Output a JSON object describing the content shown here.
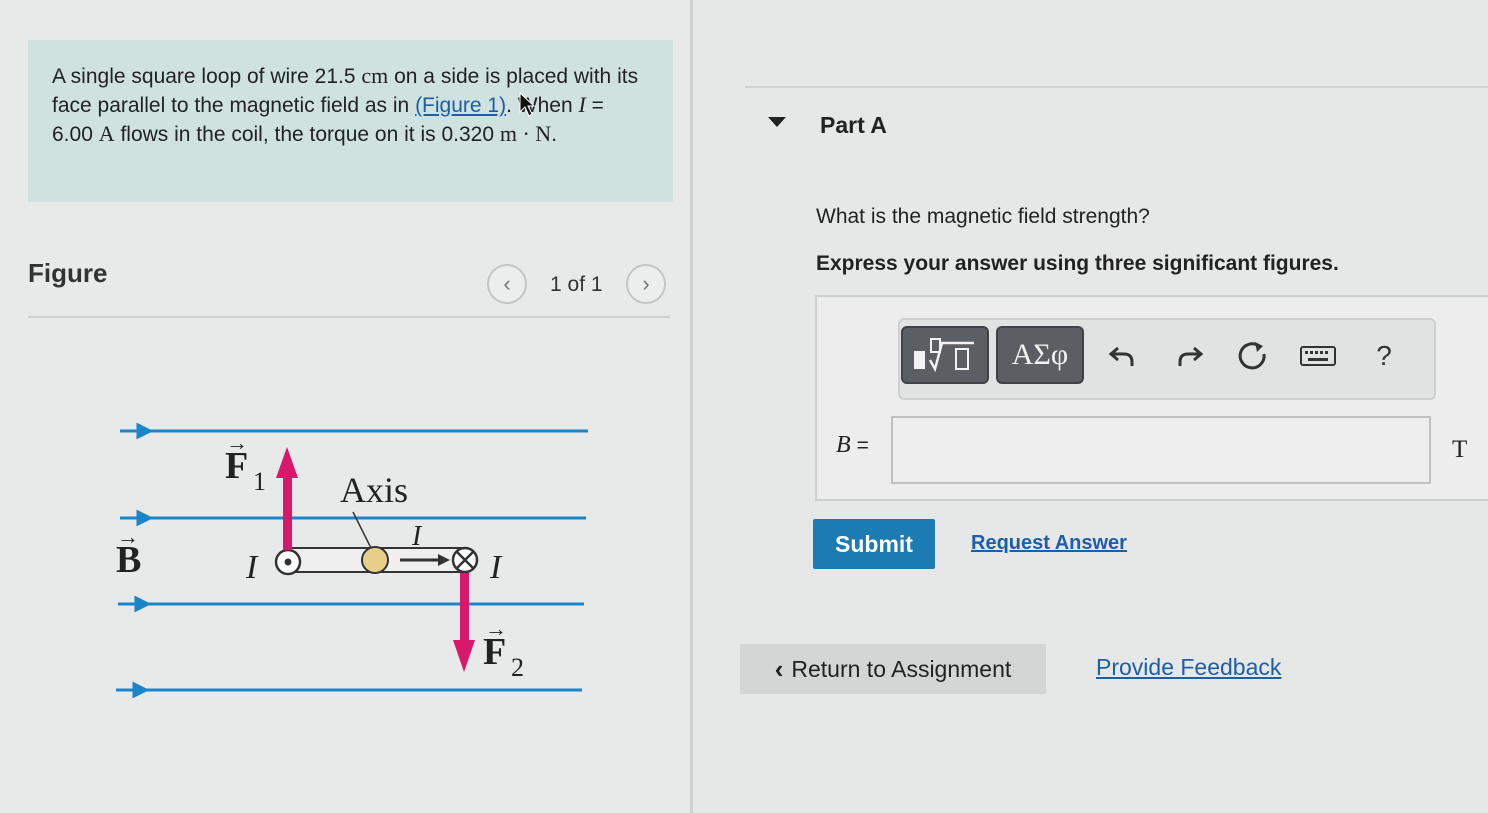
{
  "problem": {
    "text_1": "A single square loop of wire 21.5",
    "unit_cm": "cm",
    "text_2": "on a side is placed with its face parallel to the magnetic field as in",
    "figure_link": "(Figure 1)",
    "text_3": ". When",
    "var_I": "I",
    "text_4": "= 6.00",
    "unit_A": "A",
    "text_5": "flows in the coil, the torque on it is 0.320",
    "unit_mN": "m · N",
    "text_6": "."
  },
  "figure": {
    "title": "Figure",
    "pager": "1 of 1",
    "prev_icon": "chevron-left-icon",
    "next_icon": "chevron-right-icon",
    "labels": {
      "F1": "F",
      "F1_sub": "1",
      "F2": "F",
      "F2_sub": "2",
      "B": "B",
      "axis": "Axis",
      "I_left": "I",
      "I_right": "I",
      "I_mid": "I"
    },
    "colors": {
      "field_lines": "#1a86c9",
      "force": "#d8186b"
    }
  },
  "part": {
    "title": "Part A",
    "question": "What is the magnetic field strength?",
    "instruction": "Express your answer using three significant figures."
  },
  "toolbar": {
    "templates_icon": "templates-icon",
    "symbols_label": "ΑΣφ",
    "undo_icon": "undo-icon",
    "redo_icon": "redo-icon",
    "reset_icon": "reset-icon",
    "keyboard_icon": "keyboard-icon",
    "help_label": "?"
  },
  "answer": {
    "label_var": "B",
    "label_eq": "=",
    "value": "",
    "unit": "T"
  },
  "actions": {
    "submit": "Submit",
    "request_answer": "Request Answer",
    "return": "Return to Assignment",
    "feedback": "Provide Feedback"
  }
}
